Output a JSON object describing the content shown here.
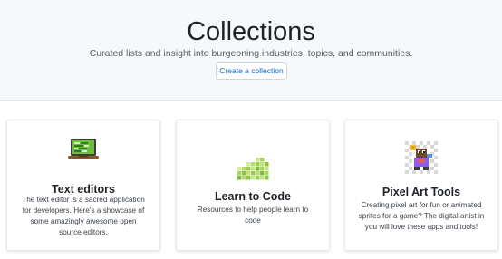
{
  "hero": {
    "title": "Collections",
    "subtitle": "Curated lists and insight into burgeoning industries, topics, and communities.",
    "button_label": "Create a collection"
  },
  "cards": [
    {
      "title": "Text editors",
      "description": "The text editor is a sacred application for developers. Here's a showcase of some amazingly awesome open source editors.",
      "icon": "laptop-icon"
    },
    {
      "title": "Learn to Code",
      "description": "Resources to help people learn to code",
      "icon": "pixel-blocks-icon"
    },
    {
      "title": "Pixel Art Tools",
      "description": "Creating pixel art for fun or animated sprites for a game? The digital artist in you will love these apps and tools!",
      "icon": "pixel-art-icon"
    }
  ],
  "colors": {
    "accent": "#0969da",
    "hero_background": "#f6f8fa"
  }
}
